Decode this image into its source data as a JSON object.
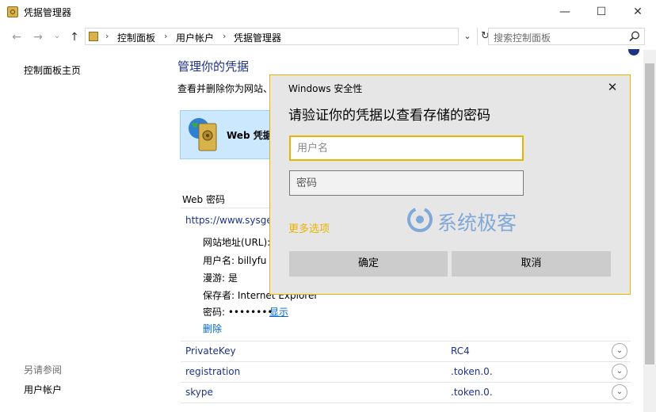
{
  "window": {
    "title": "凭据管理器",
    "minimize": "—",
    "maximize": "☐",
    "close": "✕"
  },
  "nav": {
    "back": "←",
    "forward": "→",
    "recent": "⌄",
    "up": "↑",
    "breadcrumb": [
      "控制面板",
      "用户帐户",
      "凭据管理器"
    ],
    "separator": "›",
    "dropdown": "⌄",
    "refresh": "↻",
    "search_placeholder": "搜索控制面板"
  },
  "sidebar": {
    "home": "控制面板主页",
    "see_also": "另请参阅",
    "user_accounts": "用户帐户"
  },
  "main": {
    "title": "管理你的凭据",
    "description": "查看并删除你为网站、",
    "web_cred_label": "Web 凭据",
    "web_passwords_heading": "Web 密码",
    "cred_url": "https://www.sysge",
    "details": [
      "网站地址(URL):",
      "用户名:  billyfu",
      "漫游: 是",
      "保存者:  Internet Explorer",
      "密码:  ••••••••"
    ],
    "show": "显示",
    "delete": "删除",
    "rows": [
      {
        "name": "PrivateKey",
        "value": "RC4"
      },
      {
        "name": "registration",
        "value": ".token.0."
      },
      {
        "name": "skype",
        "value": ".token.0."
      }
    ],
    "expand_glyph": "⌄"
  },
  "dialog": {
    "title": "Windows 安全性",
    "close": "✕",
    "heading": "请验证你的凭据以查看存储的密码",
    "username_placeholder": "用户名",
    "password_placeholder": "密码",
    "more_options": "更多选项",
    "ok": "确定",
    "cancel": "取消"
  },
  "watermark": {
    "text": "系统极客"
  },
  "colors": {
    "accent": "#e8b400",
    "link": "#1e3287",
    "selected": "#cce8ff"
  }
}
